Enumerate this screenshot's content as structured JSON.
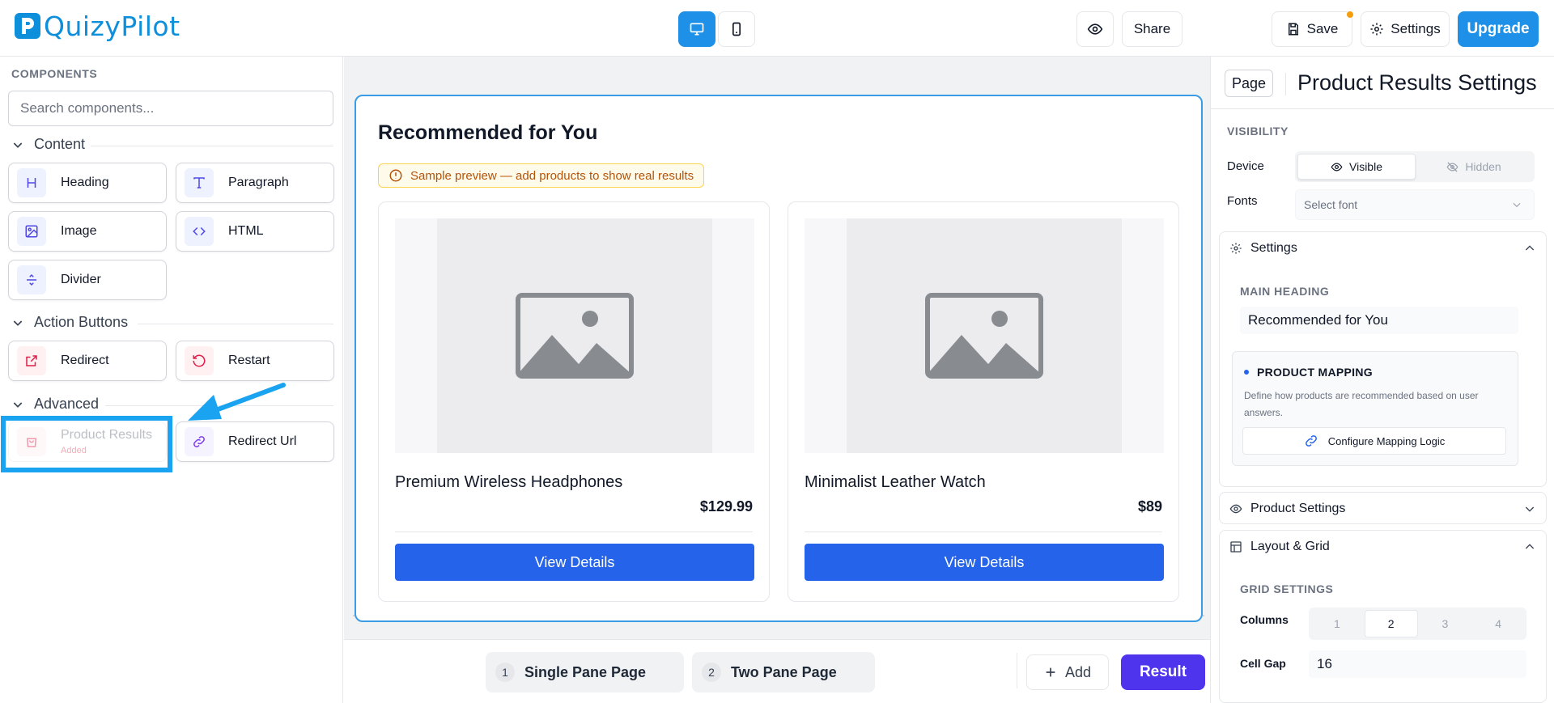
{
  "app": {
    "name": "QuizyPilot"
  },
  "topbar": {
    "share_label": "Share",
    "save_label": "Save",
    "settings_label": "Settings",
    "upgrade_label": "Upgrade"
  },
  "sidebar": {
    "title": "COMPONENTS",
    "search_placeholder": "Search components...",
    "groups": [
      {
        "label": "Content",
        "items": [
          "Heading",
          "Paragraph",
          "Image",
          "HTML",
          "Divider"
        ]
      },
      {
        "label": "Action Buttons",
        "items": [
          "Redirect",
          "Restart"
        ]
      },
      {
        "label": "Advanced",
        "items": [
          "Product Results",
          "Redirect Url"
        ]
      }
    ],
    "product_results_status": "Added"
  },
  "canvas": {
    "heading": "Recommended for You",
    "notice": "Sample preview — add products to show real results",
    "products": [
      {
        "name": "Premium Wireless Headphones",
        "price": "$129.99",
        "button": "View Details"
      },
      {
        "name": "Minimalist Leather Watch",
        "price": "$89",
        "button": "View Details"
      }
    ]
  },
  "bottombar": {
    "pages": [
      {
        "num": "1",
        "label": "Single Pane Page"
      },
      {
        "num": "2",
        "label": "Two Pane Page"
      }
    ],
    "add_label": "Add",
    "result_label": "Result"
  },
  "panel": {
    "page_tab": "Page",
    "title": "Product Results Settings",
    "visibility_label": "VISIBILITY",
    "device_label": "Device",
    "visible_label": "Visible",
    "hidden_label": "Hidden",
    "fonts_label": "Fonts",
    "font_placeholder": "Select font",
    "settings_section": "Settings",
    "main_heading_label": "MAIN HEADING",
    "main_heading_value": "Recommended for You",
    "mapping_title": "PRODUCT MAPPING",
    "mapping_desc": "Define how products are recommended based on user answers.",
    "mapping_button": "Configure Mapping Logic",
    "product_settings_section": "Product Settings",
    "layout_section": "Layout & Grid",
    "grid_settings_label": "GRID SETTINGS",
    "columns_label": "Columns",
    "columns_options": [
      "1",
      "2",
      "3",
      "4"
    ],
    "columns_selected": "2",
    "cell_gap_label": "Cell Gap",
    "cell_gap_value": "16"
  },
  "colors": {
    "brand": "#0d8fdc",
    "primary": "#2563eb",
    "result": "#4f34ee",
    "highlight": "#1aa3f0"
  }
}
